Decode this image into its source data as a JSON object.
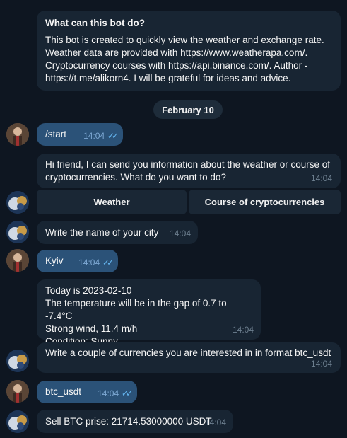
{
  "intro": {
    "title": "What can this bot do?",
    "text": "This bot is created to quickly view the weather and exchange rate. Weather data are provided with https://www.weatherapa.com/. Cryptocurrency courses with https://api.binance.com/. Author - https://t.me/alikorn4. I will be grateful for ideas and advice."
  },
  "date_separator": "February 10",
  "messages": {
    "m1": {
      "text": "/start",
      "time": "14:04"
    },
    "m2": {
      "text": "Hi friend, I can send you information about the weather or course of cryptocurrencies. What do you want to do?",
      "time": "14:04"
    },
    "m3": {
      "text": "Write the name of your city",
      "time": "14:04"
    },
    "m4": {
      "text": "Kyiv",
      "time": "14:04"
    },
    "m5": {
      "lines": [
        "Today is 2023-02-10",
        "The temperature will be in the gap of 0.7 to -7.4°C",
        "Strong wind, 11.4 m/h",
        "Condition: Sunny"
      ],
      "time": "14:04"
    },
    "m6": {
      "text": "Write a couple of currencies you are interested in in format btc_usdt",
      "time": "14:04"
    },
    "m7": {
      "text": "btc_usdt",
      "time": "14:04"
    },
    "m8": {
      "text": "Sell BTC prise: 21714.53000000 USDT",
      "time": "14:04"
    }
  },
  "keyboard": {
    "weather_label": "Weather",
    "crypto_label": "Course of cryptocurrencies"
  },
  "colors": {
    "background": "#0e1621",
    "incoming_bubble": "#182533",
    "outgoing_bubble": "#2b5278",
    "read_ticks": "#64b5ef"
  }
}
